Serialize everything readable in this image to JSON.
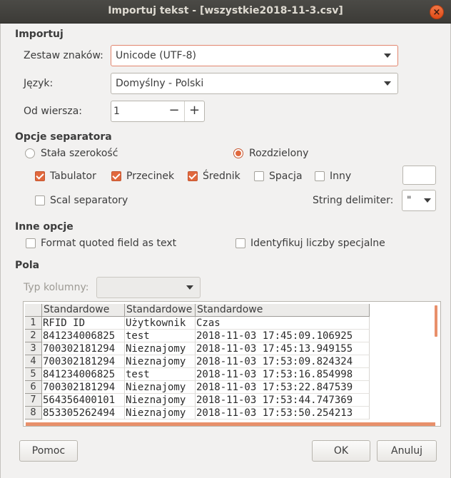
{
  "window": {
    "title": "Importuj tekst - [wszystkie2018-11-3.csv]",
    "close_label": "×"
  },
  "import": {
    "section": "Importuj",
    "charset_label": "Zestaw znaków:",
    "charset_value": "Unicode (UTF-8)",
    "language_label": "Język:",
    "language_value": "Domyślny - Polski",
    "from_row_label": "Od wiersza:",
    "from_row_value": "1",
    "minus": "−",
    "plus": "+"
  },
  "separator": {
    "section": "Opcje separatora",
    "fixed_width": "Stała szerokość",
    "separated": "Rozdzielony",
    "tab": "Tabulator",
    "comma": "Przecinek",
    "semicolon": "Średnik",
    "space": "Spacja",
    "other": "Inny",
    "merge": "Scal separatory",
    "string_delimiter_label": "String delimiter:",
    "string_delimiter_value": "\""
  },
  "other_options": {
    "section": "Inne opcje",
    "quoted_as_text": "Format quoted field as text",
    "special_numbers": "Identyfikuj liczby specjalne"
  },
  "fields": {
    "section": "Pola",
    "column_type_label": "Typ kolumny:",
    "headers": [
      "Standardowe",
      "Standardowe",
      "Standardowe"
    ],
    "rows": [
      {
        "n": "1",
        "c": [
          "RFID ID",
          "Użytkownik",
          "Czas"
        ]
      },
      {
        "n": "2",
        "c": [
          "841234006825",
          "test",
          "2018-11-03 17:45:09.106925"
        ]
      },
      {
        "n": "3",
        "c": [
          "700302181294",
          "Nieznajomy",
          "2018-11-03 17:45:13.949155"
        ]
      },
      {
        "n": "4",
        "c": [
          "700302181294",
          "Nieznajomy",
          "2018-11-03 17:53:09.824324"
        ]
      },
      {
        "n": "5",
        "c": [
          "841234006825",
          "test",
          "2018-11-03 17:53:16.854998"
        ]
      },
      {
        "n": "6",
        "c": [
          "700302181294",
          "Nieznajomy",
          "2018-11-03 17:53:22.847539"
        ]
      },
      {
        "n": "7",
        "c": [
          "564356400101",
          "Nieznajomy",
          "2018-11-03 17:53:44.747369"
        ]
      },
      {
        "n": "8",
        "c": [
          "853305262494",
          "Nieznajomy",
          "2018-11-03 17:53:50.254213"
        ]
      }
    ]
  },
  "buttons": {
    "help": "Pomoc",
    "ok": "OK",
    "cancel": "Anuluj"
  }
}
